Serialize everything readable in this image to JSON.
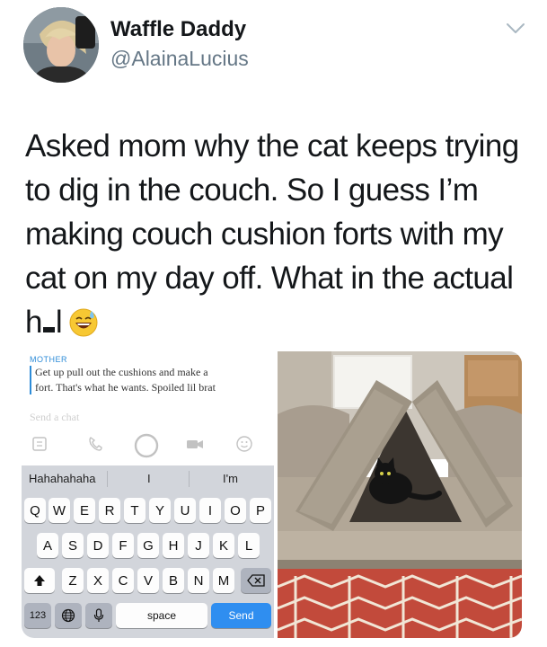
{
  "tweet": {
    "display_name": "Waffle Daddy",
    "handle": "@AlainaLucius",
    "lines": [
      "Asked mom why the cat keeps trying",
      "to dig in the couch. So I guess I’m",
      "making couch cushion forts with my",
      "cat on my day off. What in the actual"
    ],
    "last_line_start": "h",
    "last_line_end": "l",
    "emoji": "grinning-face-with-sweat"
  },
  "snapchat": {
    "sender_label": "MOTHER",
    "message_line1": "Get up pull out the cushions and make a",
    "message_line2": "fort. That's what he wants.  Spoiled lil brat",
    "input_placeholder": "Send a chat",
    "predictions": [
      "Hahahahaha",
      "I",
      "I'm"
    ],
    "keyboard_rows": [
      [
        "Q",
        "W",
        "E",
        "R",
        "T",
        "Y",
        "U",
        "I",
        "O",
        "P"
      ],
      [
        "A",
        "S",
        "D",
        "F",
        "G",
        "H",
        "J",
        "K",
        "L"
      ],
      [
        "Z",
        "X",
        "C",
        "V",
        "B",
        "N",
        "M"
      ]
    ],
    "numbers_key": "123",
    "space_key": "space",
    "send_key": "Send",
    "accent_color": "#2e8cd8",
    "send_color": "#2f8ef0"
  }
}
